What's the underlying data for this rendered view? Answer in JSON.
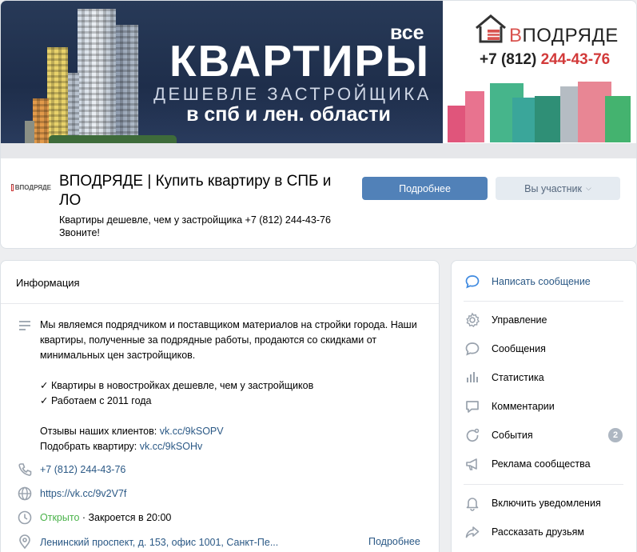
{
  "banner": {
    "vse": "все",
    "title": "КВАРТИРЫ",
    "subtitle": "ДЕШЕВЛЕ ЗАСТРОЙЩИКА",
    "region": "в спб и лен. области",
    "logo_text_v": "В",
    "logo_text_rest": "ПОДРЯДЕ",
    "phone_prefix": "+7 (812)",
    "phone_number": "244-43-76"
  },
  "group": {
    "avatar_text": "ВПОДРЯДЕ",
    "name": "ВПОДРЯДЕ | Купить квартиру в СПБ и ЛО",
    "status": "Квартиры дешевле, чем у застройщика +7 (812) 244-43-76 Звоните!",
    "more_button": "Подробнее",
    "member_button": "Вы участник"
  },
  "info": {
    "title": "Информация",
    "description": [
      "Мы являемся подрядчиком и поставщиком материалов на стройки города. Наши квартиры, полученные за подрядные работы, продаются со скидками от минимальных цен застройщиков."
    ],
    "checks": [
      "✓ Квартиры в новостройках дешевле, чем у застройщиков",
      "✓ Работаем с 2011 года"
    ],
    "reviews_label": "Отзывы наших клиентов: ",
    "reviews_link": "vk.cc/9kSOPV",
    "pick_label": "Подобрать квартиру: ",
    "pick_link": "vk.cc/9kSOHv",
    "phone": "+7 (812) 244-43-76",
    "website": "https://vk.cc/9v2V7f",
    "open_status": "Открыто",
    "close_time": " · Закроется в 20:00",
    "address": "Ленинский проспект, д. 153, офис 1001, Санкт-Пе...",
    "address_more": "Подробнее"
  },
  "side": {
    "items": [
      {
        "label": "Написать сообщение",
        "icon": "message-bubble-icon"
      },
      {
        "label": "Управление",
        "icon": "gear-icon"
      },
      {
        "label": "Сообщения",
        "icon": "chat-icon"
      },
      {
        "label": "Статистика",
        "icon": "stats-icon"
      },
      {
        "label": "Комментарии",
        "icon": "comment-icon"
      },
      {
        "label": "События",
        "icon": "events-icon"
      },
      {
        "label": "Реклама сообщества",
        "icon": "megaphone-icon"
      },
      {
        "label": "Включить уведомления",
        "icon": "bell-icon"
      },
      {
        "label": "Рассказать друзьям",
        "icon": "share-icon"
      }
    ],
    "events_count": "2"
  },
  "colors": {
    "accent": "#5181b8",
    "link": "#2a5885",
    "open": "#4bb34b",
    "banner_bg": "#1f2f4c",
    "phone_red": "#d23a3a"
  }
}
